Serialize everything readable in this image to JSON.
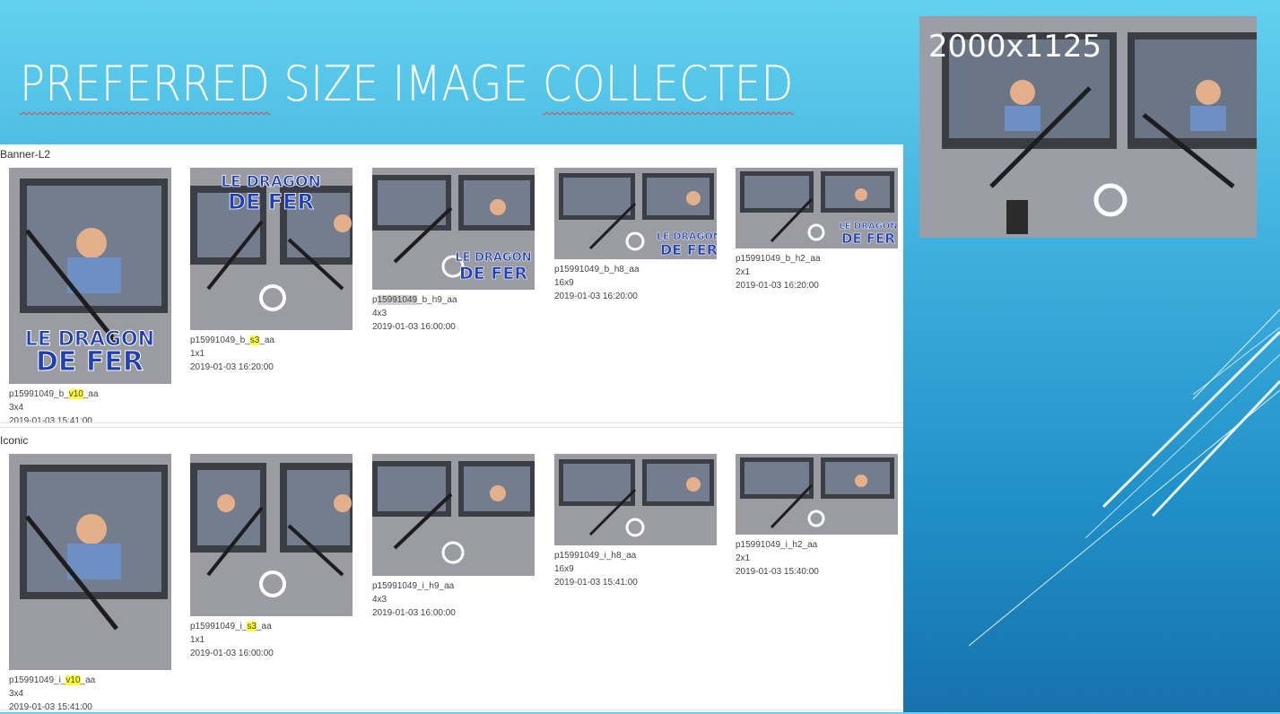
{
  "slide": {
    "title_parts": [
      "PREFERRED",
      "SIZE IMAGE",
      "COLLECTED"
    ]
  },
  "preview": {
    "label": "2000x1125"
  },
  "sections": [
    {
      "label": "Banner-L2",
      "items": [
        {
          "name_pre": "p15991049_b_",
          "name_hl": "v10",
          "name_post": "_aa",
          "ratio": "3x4",
          "date": "2019-01-03 15:41:00",
          "banner_text": [
            "LE DRAGON",
            "DE FER"
          ]
        },
        {
          "name_pre": "p15991049_b_",
          "name_hl": "s3",
          "name_post": "_aa",
          "ratio": "1x1",
          "date": "2019-01-03 16:20:00",
          "banner_text": [
            "LE DRAGON",
            "DE FER"
          ]
        },
        {
          "name_pre": "p",
          "name_hl": "15991049",
          "name_post": "_b_h9_aa",
          "ratio": "4x3",
          "date": "2019-01-03 16:00:00",
          "banner_text": [
            "LE DRAGON",
            "DE FER"
          ]
        },
        {
          "name_pre": "p15991049_b_h8_aa",
          "name_hl": "",
          "name_post": "",
          "ratio": "16x9",
          "date": "2019-01-03 16:20:00",
          "banner_text": [
            "LE DRAGON",
            "DE FER"
          ]
        },
        {
          "name_pre": "p15991049_b_h2_aa",
          "name_hl": "",
          "name_post": "",
          "ratio": "2x1",
          "date": "2019-01-03 16:20:00",
          "banner_text": [
            "LE DRAGON",
            "DE FER"
          ]
        }
      ]
    },
    {
      "label": "Iconic",
      "items": [
        {
          "name_pre": "p15991049_i_",
          "name_hl": "v10",
          "name_post": "_aa",
          "ratio": "3x4",
          "date": "2019-01-03 15:41:00"
        },
        {
          "name_pre": "p15991049_i_",
          "name_hl": "s3",
          "name_post": "_aa",
          "ratio": "1x1",
          "date": "2019-01-03 16:00:00"
        },
        {
          "name_pre": "p15991049_i_h9_aa",
          "name_hl": "",
          "name_post": "",
          "ratio": "4x3",
          "date": "2019-01-03 16:00:00"
        },
        {
          "name_pre": "p15991049_i_h8_aa",
          "name_hl": "",
          "name_post": "",
          "ratio": "16x9",
          "date": "2019-01-03 15:41:00"
        },
        {
          "name_pre": "p15991049_i_h2_aa",
          "name_hl": "",
          "name_post": "",
          "ratio": "2x1",
          "date": "2019-01-03 15:40:00"
        }
      ]
    }
  ]
}
